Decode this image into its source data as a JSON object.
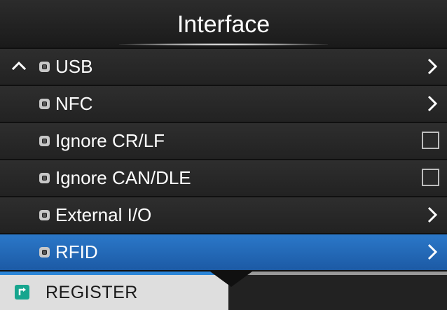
{
  "header": {
    "title": "Interface"
  },
  "menu": {
    "items": [
      {
        "label": "USB",
        "control": "chevron",
        "icon": "lock-icon",
        "selected": false,
        "has_caret_up": true
      },
      {
        "label": "NFC",
        "control": "chevron",
        "icon": "lock-icon",
        "selected": false,
        "has_caret_up": false
      },
      {
        "label": "Ignore CR/LF",
        "control": "checkbox",
        "checked": false,
        "icon": "lock-icon",
        "selected": false,
        "has_caret_up": false
      },
      {
        "label": "Ignore CAN/DLE",
        "control": "checkbox",
        "checked": false,
        "icon": "lock-icon",
        "selected": false,
        "has_caret_up": false
      },
      {
        "label": "External I/O",
        "control": "chevron",
        "icon": "lock-icon",
        "selected": false,
        "has_caret_up": false
      },
      {
        "label": "RFID",
        "control": "chevron",
        "icon": "lock-icon",
        "selected": true,
        "has_caret_up": false
      }
    ]
  },
  "footer": {
    "register_label": "REGISTER",
    "register_icon": "register-icon"
  },
  "colors": {
    "selected_row": "#2b78c9",
    "accent_line": "#2b86d8",
    "register_icon": "#17a58e"
  }
}
